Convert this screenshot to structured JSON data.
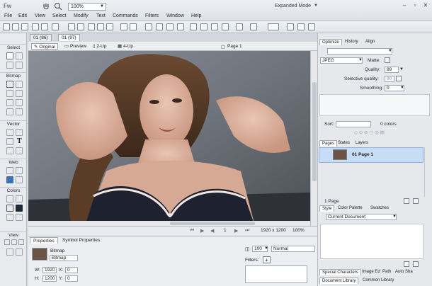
{
  "app": {
    "logo": "Fw",
    "mode": "Expanded Mode",
    "zoom": "100%"
  },
  "menu": [
    "File",
    "Edit",
    "View",
    "Select",
    "Modify",
    "Text",
    "Commands",
    "Filters",
    "Window",
    "Help"
  ],
  "tools": {
    "sections": [
      "Select",
      "Bitmap",
      "Vector",
      "Web",
      "Colors",
      "View"
    ]
  },
  "document": {
    "tabs": [
      "01 (86)",
      "01 (97)"
    ],
    "views": [
      "Original",
      "Preview",
      "2-Up",
      "4-Up"
    ],
    "page_name": "Page 1",
    "frame_count": "1",
    "dimensions": "1920 x 1200",
    "status_zoom": "100%"
  },
  "properties": {
    "tabs": [
      "Properties",
      "Symbol Properties"
    ],
    "type": "Bitmap",
    "name": "Bitmap",
    "w_label": "W:",
    "w": "1920",
    "x_label": "X:",
    "x": "0",
    "h_label": "H:",
    "h": "1200",
    "y_label": "Y:",
    "y": "0",
    "opacity": "100",
    "blend": "Normal",
    "filters_label": "Filters:",
    "filters_add": "+"
  },
  "optimize": {
    "tabs": [
      "Optimize",
      "History",
      "Align"
    ],
    "format": "JPEG",
    "matte_label": "Matte:",
    "quality_label": "Quality:",
    "quality": "99",
    "selective_label": "Selective quality:",
    "selective": "90",
    "smoothing_label": "Smoothing:",
    "smoothing": "0",
    "sort_label": "Sort:",
    "colors": "0 colors"
  },
  "pages": {
    "tabs": [
      "Pages",
      "States",
      "Layers"
    ],
    "items": [
      {
        "label": "01  Page 1"
      }
    ],
    "footer": "1 Page"
  },
  "style": {
    "tabs": [
      "Style",
      "Color Palette",
      "Swatches"
    ],
    "selection": "Current Document"
  },
  "bottom_tabs": {
    "row1": [
      "Special Characters",
      "Image Ed",
      "Path",
      "Auto Sha"
    ],
    "row2": [
      "Document Library",
      "Common Library"
    ]
  },
  "colors": {
    "accent": "#3d6fb6",
    "selection": "#c9dcf5",
    "panel": "#e6e8eb"
  }
}
